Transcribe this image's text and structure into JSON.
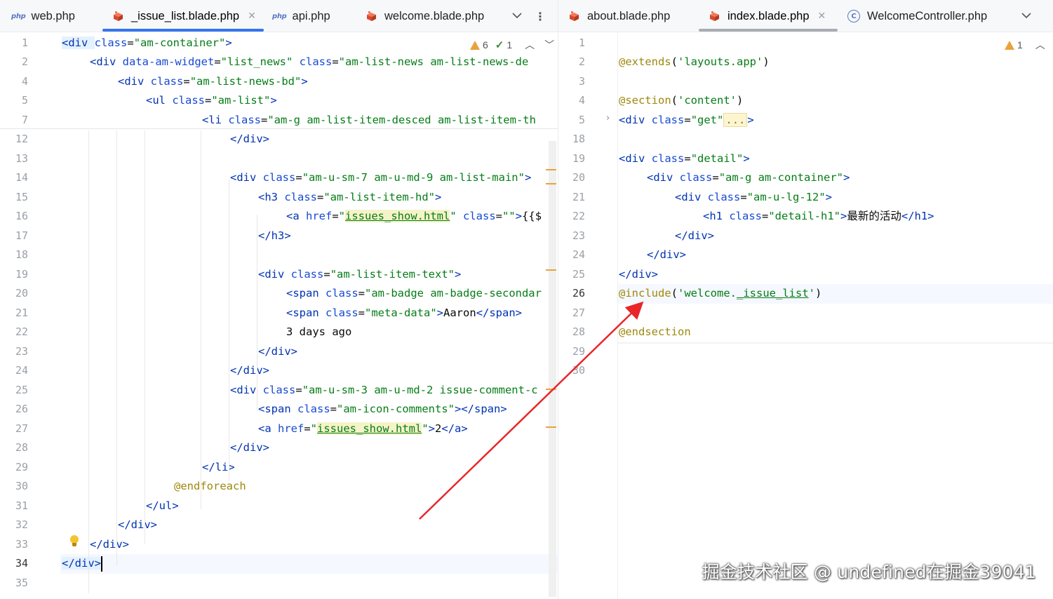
{
  "left": {
    "tabs": [
      {
        "icon": "php-icon",
        "icon_text": "php",
        "label": "web.php",
        "active": false,
        "closable": false
      },
      {
        "icon": "blade-icon",
        "label": "_issue_list.blade.php",
        "active": true,
        "closable": true
      },
      {
        "icon": "php-icon",
        "icon_text": "php",
        "label": "api.php",
        "active": false,
        "closable": false
      },
      {
        "icon": "blade-icon",
        "label": "welcome.blade.php",
        "active": false,
        "closable": false
      }
    ],
    "inspections": {
      "warnings": "6",
      "checks": "1"
    },
    "line_numbers": [
      "1",
      "2",
      "4",
      "5",
      "7",
      "12",
      "13",
      "14",
      "15",
      "16",
      "17",
      "18",
      "19",
      "20",
      "21",
      "22",
      "23",
      "24",
      "25",
      "26",
      "27",
      "28",
      "29",
      "30",
      "31",
      "32",
      "33",
      "34",
      "35"
    ],
    "current_line": "34",
    "code": [
      [
        [
          "t",
          "<div "
        ],
        [
          "a",
          "class"
        ],
        [
          "p",
          "="
        ],
        [
          "s",
          "\"am-container\""
        ],
        [
          "t",
          ">"
        ]
      ],
      [
        [
          "t",
          "<div "
        ],
        [
          "a",
          "data-am-widget"
        ],
        [
          "p",
          "="
        ],
        [
          "s",
          "\"list_news\" "
        ],
        [
          "a",
          "class"
        ],
        [
          "p",
          "="
        ],
        [
          "s",
          "\"am-list-news am-list-news-de"
        ]
      ],
      [
        [
          "t",
          "<div "
        ],
        [
          "a",
          "class"
        ],
        [
          "p",
          "="
        ],
        [
          "s",
          "\"am-list-news-bd\""
        ],
        [
          "t",
          ">"
        ]
      ],
      [
        [
          "t",
          "<ul "
        ],
        [
          "a",
          "class"
        ],
        [
          "p",
          "="
        ],
        [
          "s",
          "\"am-list\""
        ],
        [
          "t",
          ">"
        ]
      ],
      [
        [
          "t",
          "<li "
        ],
        [
          "a",
          "class"
        ],
        [
          "p",
          "="
        ],
        [
          "s",
          "\"am-g am-list-item-desced am-list-item-th"
        ]
      ],
      [
        [
          "t",
          "</div>"
        ]
      ],
      [],
      [
        [
          "t",
          "<div "
        ],
        [
          "a",
          "class"
        ],
        [
          "p",
          "="
        ],
        [
          "s",
          "\"am-u-sm-7 am-u-md-9 am-list-main\""
        ],
        [
          "t",
          ">"
        ]
      ],
      [
        [
          "t",
          "<h3 "
        ],
        [
          "a",
          "class"
        ],
        [
          "p",
          "="
        ],
        [
          "s",
          "\"am-list-item-hd\""
        ],
        [
          "t",
          ">"
        ]
      ],
      [
        [
          "t",
          "<a "
        ],
        [
          "a",
          "href"
        ],
        [
          "p",
          "="
        ],
        [
          "s",
          "\""
        ],
        [
          "u",
          "issues_show.html"
        ],
        [
          "s",
          "\" "
        ],
        [
          "a",
          "class"
        ],
        [
          "p",
          "="
        ],
        [
          "s",
          "\"\""
        ],
        [
          "t",
          ">"
        ],
        [
          "p",
          "{{$"
        ]
      ],
      [
        [
          "t",
          "</h3>"
        ]
      ],
      [],
      [
        [
          "t",
          "<div "
        ],
        [
          "a",
          "class"
        ],
        [
          "p",
          "="
        ],
        [
          "s",
          "\"am-list-item-text\""
        ],
        [
          "t",
          ">"
        ]
      ],
      [
        [
          "t",
          "<span "
        ],
        [
          "a",
          "class"
        ],
        [
          "p",
          "="
        ],
        [
          "s",
          "\"am-badge am-badge-secondar"
        ]
      ],
      [
        [
          "t",
          "<span "
        ],
        [
          "a",
          "class"
        ],
        [
          "p",
          "="
        ],
        [
          "s",
          "\"meta-data\""
        ],
        [
          "t",
          ">"
        ],
        [
          "p",
          "Aaron"
        ],
        [
          "t",
          "</span>"
        ]
      ],
      [
        [
          "p",
          "3 days ago"
        ]
      ],
      [
        [
          "t",
          "</div>"
        ]
      ],
      [
        [
          "t",
          "</div>"
        ]
      ],
      [
        [
          "t",
          "<div "
        ],
        [
          "a",
          "class"
        ],
        [
          "p",
          "="
        ],
        [
          "s",
          "\"am-u-sm-3 am-u-md-2 issue-comment-c"
        ]
      ],
      [
        [
          "t",
          "<span "
        ],
        [
          "a",
          "class"
        ],
        [
          "p",
          "="
        ],
        [
          "s",
          "\"am-icon-comments\""
        ],
        [
          "t",
          "></span>"
        ]
      ],
      [
        [
          "t",
          "<a "
        ],
        [
          "a",
          "href"
        ],
        [
          "p",
          "="
        ],
        [
          "s",
          "\""
        ],
        [
          "u",
          "issues_show.html"
        ],
        [
          "s",
          "\""
        ],
        [
          "t",
          ">"
        ],
        [
          "p",
          "2"
        ],
        [
          "t",
          "</a>"
        ]
      ],
      [
        [
          "t",
          "</div>"
        ]
      ],
      [
        [
          "t",
          "</li>"
        ]
      ],
      [
        [
          "d",
          "@endforeach"
        ]
      ],
      [
        [
          "t",
          "</ul>"
        ]
      ],
      [
        [
          "t",
          "</div>"
        ]
      ],
      [
        [
          "t",
          "</div>"
        ]
      ],
      [
        [
          "t",
          "</div>"
        ]
      ],
      []
    ]
  },
  "right": {
    "tabs": [
      {
        "icon": "blade-icon",
        "label": "about.blade.php",
        "active": false,
        "closable": false
      },
      {
        "icon": "blade-icon",
        "label": "index.blade.php",
        "active": true,
        "closable": true
      },
      {
        "icon": "controller-icon",
        "icon_text": "C",
        "label": "WelcomeController.php",
        "active": false,
        "closable": false
      }
    ],
    "inspections": {
      "warnings": "1"
    },
    "line_numbers": [
      "1",
      "2",
      "3",
      "4",
      "5",
      "18",
      "19",
      "20",
      "21",
      "22",
      "23",
      "24",
      "25",
      "26",
      "27",
      "28",
      "29",
      "30"
    ],
    "current_line": "26",
    "code": [
      [],
      [
        [
          "d",
          "@extends"
        ],
        [
          "p",
          "("
        ],
        [
          "s",
          "'layouts.app'"
        ],
        [
          "p",
          ")"
        ]
      ],
      [],
      [
        [
          "d",
          "@section"
        ],
        [
          "p",
          "("
        ],
        [
          "s",
          "'content'"
        ],
        [
          "p",
          ")"
        ]
      ],
      [
        [
          "t",
          "<div "
        ],
        [
          "a",
          "class"
        ],
        [
          "p",
          "="
        ],
        [
          "s",
          "\"get\""
        ],
        [
          "f",
          "..."
        ],
        [
          "t",
          ">"
        ]
      ],
      [],
      [
        [
          "t",
          "<div "
        ],
        [
          "a",
          "class"
        ],
        [
          "p",
          "="
        ],
        [
          "s",
          "\"detail\""
        ],
        [
          "t",
          ">"
        ]
      ],
      [
        [
          "t",
          "<div "
        ],
        [
          "a",
          "class"
        ],
        [
          "p",
          "="
        ],
        [
          "s",
          "\"am-g am-container\""
        ],
        [
          "t",
          ">"
        ]
      ],
      [
        [
          "t",
          "<div "
        ],
        [
          "a",
          "class"
        ],
        [
          "p",
          "="
        ],
        [
          "s",
          "\"am-u-lg-12\""
        ],
        [
          "t",
          ">"
        ]
      ],
      [
        [
          "t",
          "<h1 "
        ],
        [
          "a",
          "class"
        ],
        [
          "p",
          "="
        ],
        [
          "s",
          "\"detail-h1\""
        ],
        [
          "t",
          ">"
        ],
        [
          "p",
          "最新的活动"
        ],
        [
          "t",
          "</h1>"
        ]
      ],
      [
        [
          "t",
          "</div>"
        ]
      ],
      [
        [
          "t",
          "</div>"
        ]
      ],
      [
        [
          "t",
          "</div>"
        ]
      ],
      [
        [
          "d",
          "@include"
        ],
        [
          "p",
          "("
        ],
        [
          "s",
          "'welcome."
        ],
        [
          "su",
          "_issue_list"
        ],
        [
          "s",
          "'"
        ],
        [
          "p",
          ")"
        ]
      ],
      [],
      [
        [
          "d",
          "@endsection"
        ]
      ],
      [],
      []
    ]
  },
  "colors": {
    "accent": "#3574f0",
    "tag": "#0033b3",
    "attr": "#174ad4",
    "string": "#067d17",
    "directive": "#9e880d",
    "arrow": "#e8262a"
  },
  "watermark": "掘金技术社区 @ undefined在掘金39041"
}
